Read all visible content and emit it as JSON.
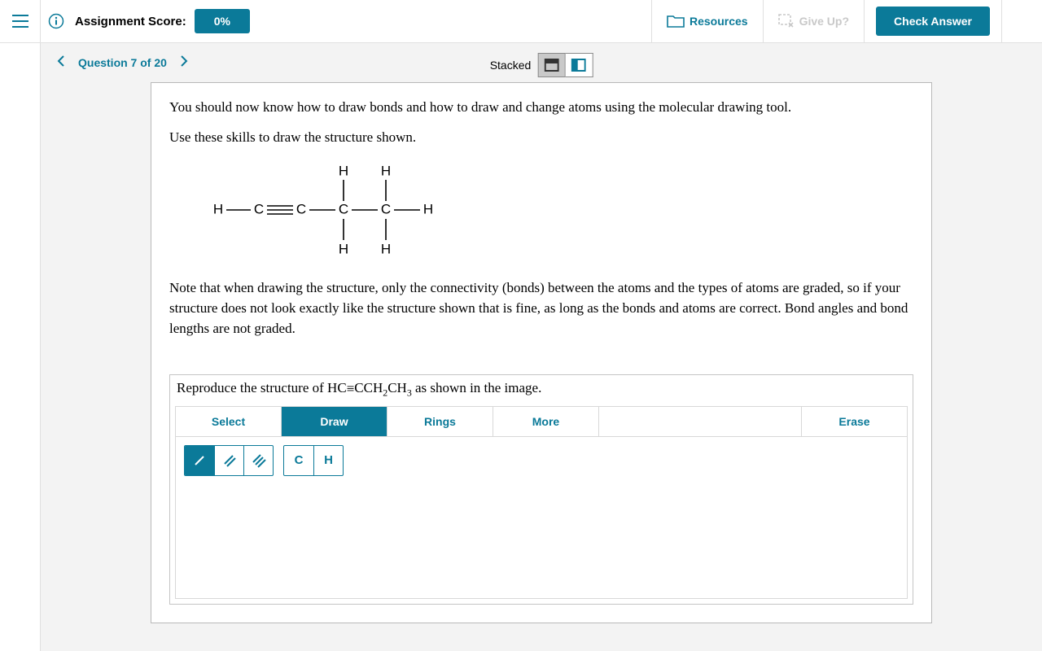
{
  "header": {
    "score_label": "Assignment Score:",
    "score_value": "0%",
    "resources": "Resources",
    "give_up": "Give Up?",
    "check_answer": "Check Answer"
  },
  "nav": {
    "question_label": "Question 7 of 20",
    "view_label": "Stacked"
  },
  "question": {
    "intro1": "You should now know how to draw bonds and how to draw and change atoms using the molecular drawing tool.",
    "intro2": "Use these skills to draw the structure shown.",
    "note": "Note that when drawing the structure, only the connectivity (bonds) between the atoms and the types of atoms are graded, so if your structure does not look exactly like the structure shown that is fine, as long as the bonds and atoms are correct. Bond angles and bond lengths are not graded.",
    "prompt_prefix": "Reproduce the structure of HC",
    "prompt_formula_mid": "CCH",
    "prompt_sub1": "2",
    "prompt_formula_mid2": "CH",
    "prompt_sub2": "3",
    "prompt_suffix": " as shown in the image."
  },
  "molecule": {
    "atoms": [
      "H",
      "C",
      "C",
      "C",
      "C",
      "H",
      "H",
      "H",
      "H",
      "H"
    ],
    "bonds_description": "H-C≡C-C(H)(H)-C(H)(H)-H : 1-butyne with explicit hydrogens on sp3 carbons",
    "labels": {
      "H": "H",
      "C": "C"
    }
  },
  "tools": {
    "tabs": {
      "select": "Select",
      "draw": "Draw",
      "rings": "Rings",
      "more": "More",
      "erase": "Erase"
    },
    "bond_single": "/",
    "bond_double": "//",
    "bond_triple": "///",
    "atom_c": "C",
    "atom_h": "H"
  }
}
